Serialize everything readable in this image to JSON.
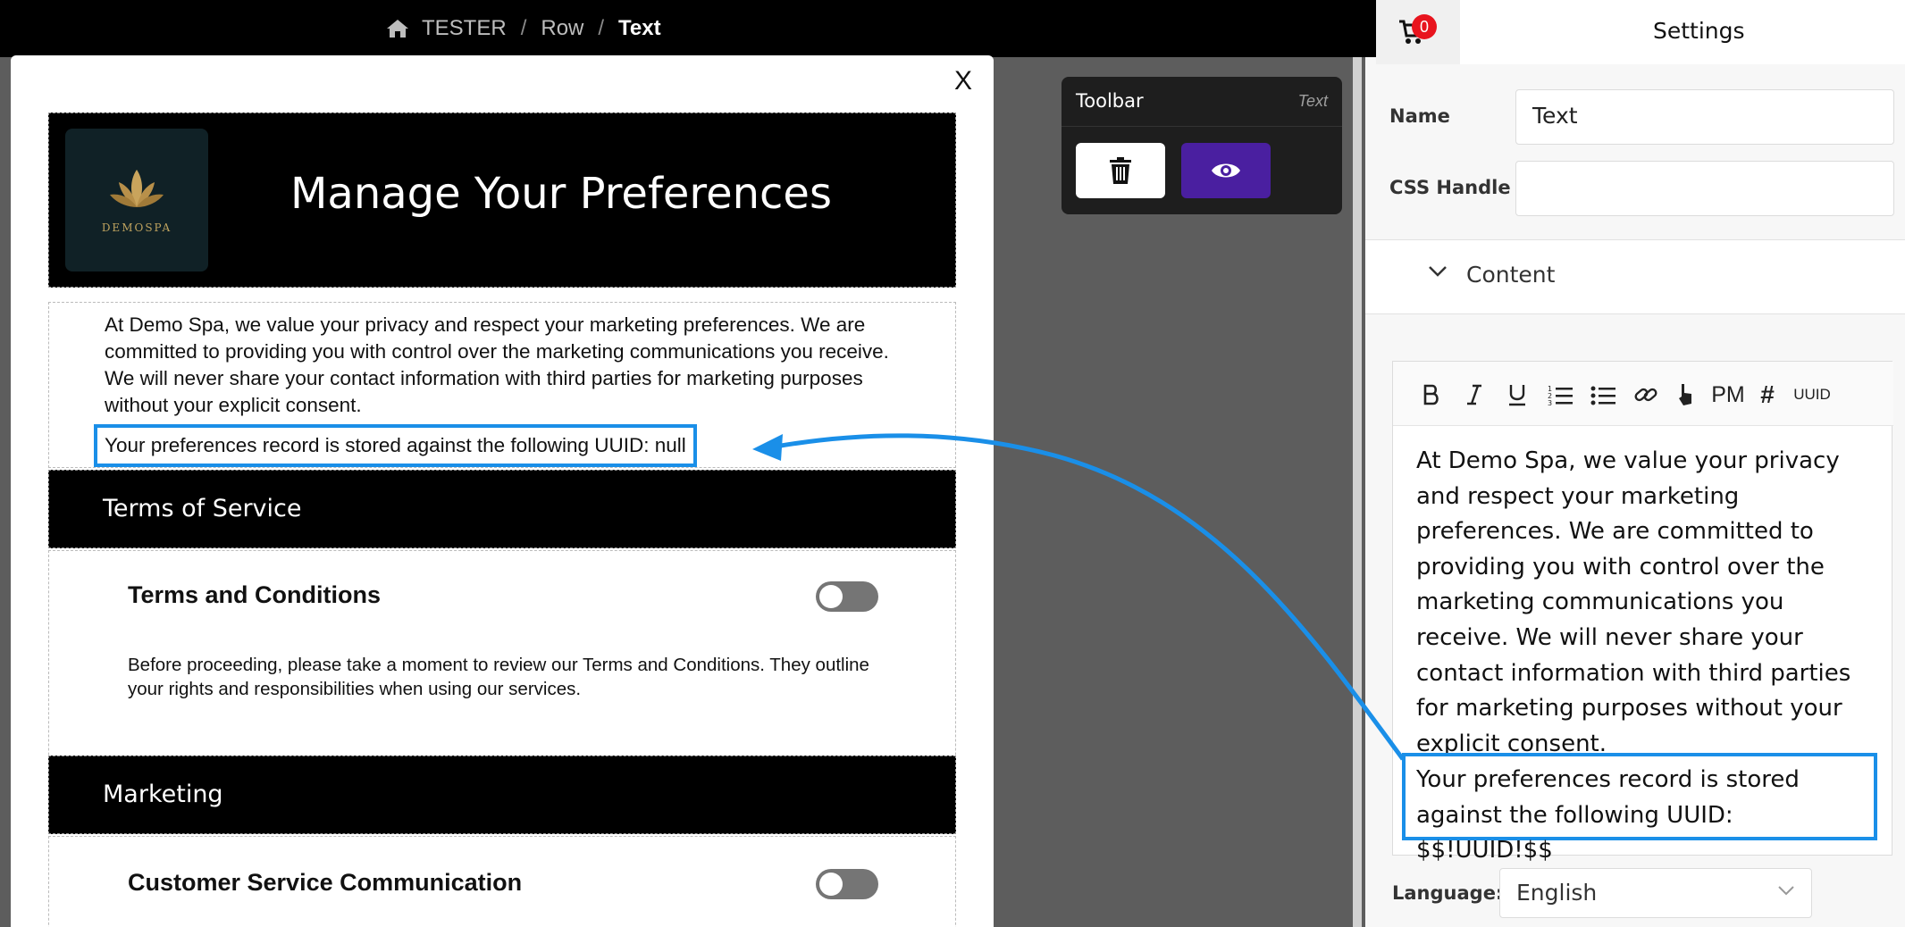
{
  "breadcrumb": {
    "items": [
      "TESTER",
      "Row",
      "Text"
    ],
    "separator": "/"
  },
  "modal": {
    "close_label": "X",
    "banner": {
      "title": "Manage Your Preferences",
      "logo_text": "DEMOSPA"
    },
    "intro_text": "At Demo Spa, we value your privacy and respect your marketing preferences. We are committed to providing you with control over the marketing communications you receive. We will never share your contact information with third parties for marketing purposes without your explicit consent.",
    "uuid_text": "Your preferences record is stored against the following UUID: null",
    "sections": [
      {
        "title": "Terms of Service"
      },
      {
        "title": "Marketing"
      }
    ],
    "terms": {
      "title": "Terms and Conditions",
      "description": "Before proceeding, please take a moment to review our Terms and Conditions. They outline your rights and responsibilities when using our services."
    },
    "customer_service": {
      "title": "Customer Service Communication"
    }
  },
  "toolbar": {
    "title": "Toolbar",
    "type": "Text"
  },
  "panel": {
    "cart_count": "0",
    "title": "Settings",
    "name_label": "Name",
    "name_value": "Text",
    "css_label": "CSS Handle",
    "css_value": "",
    "content_label": "Content",
    "editor": {
      "buttons": {
        "pm": "PM",
        "hash": "#",
        "uuid": "UUID"
      },
      "text": "At Demo Spa, we value your privacy and respect your marketing preferences. We are committed to providing you with control over the marketing communications you receive. We will never share your contact information with third parties for marketing purposes without your explicit consent.",
      "uuid_text": "Your preferences record is stored against the following UUID: $$!UUID!$$"
    },
    "language_label": "Language:",
    "language_value": "English"
  },
  "colors": {
    "accent": "#1a8fe8",
    "preview_button": "#4a1fa0",
    "badge": "#e8141e"
  }
}
